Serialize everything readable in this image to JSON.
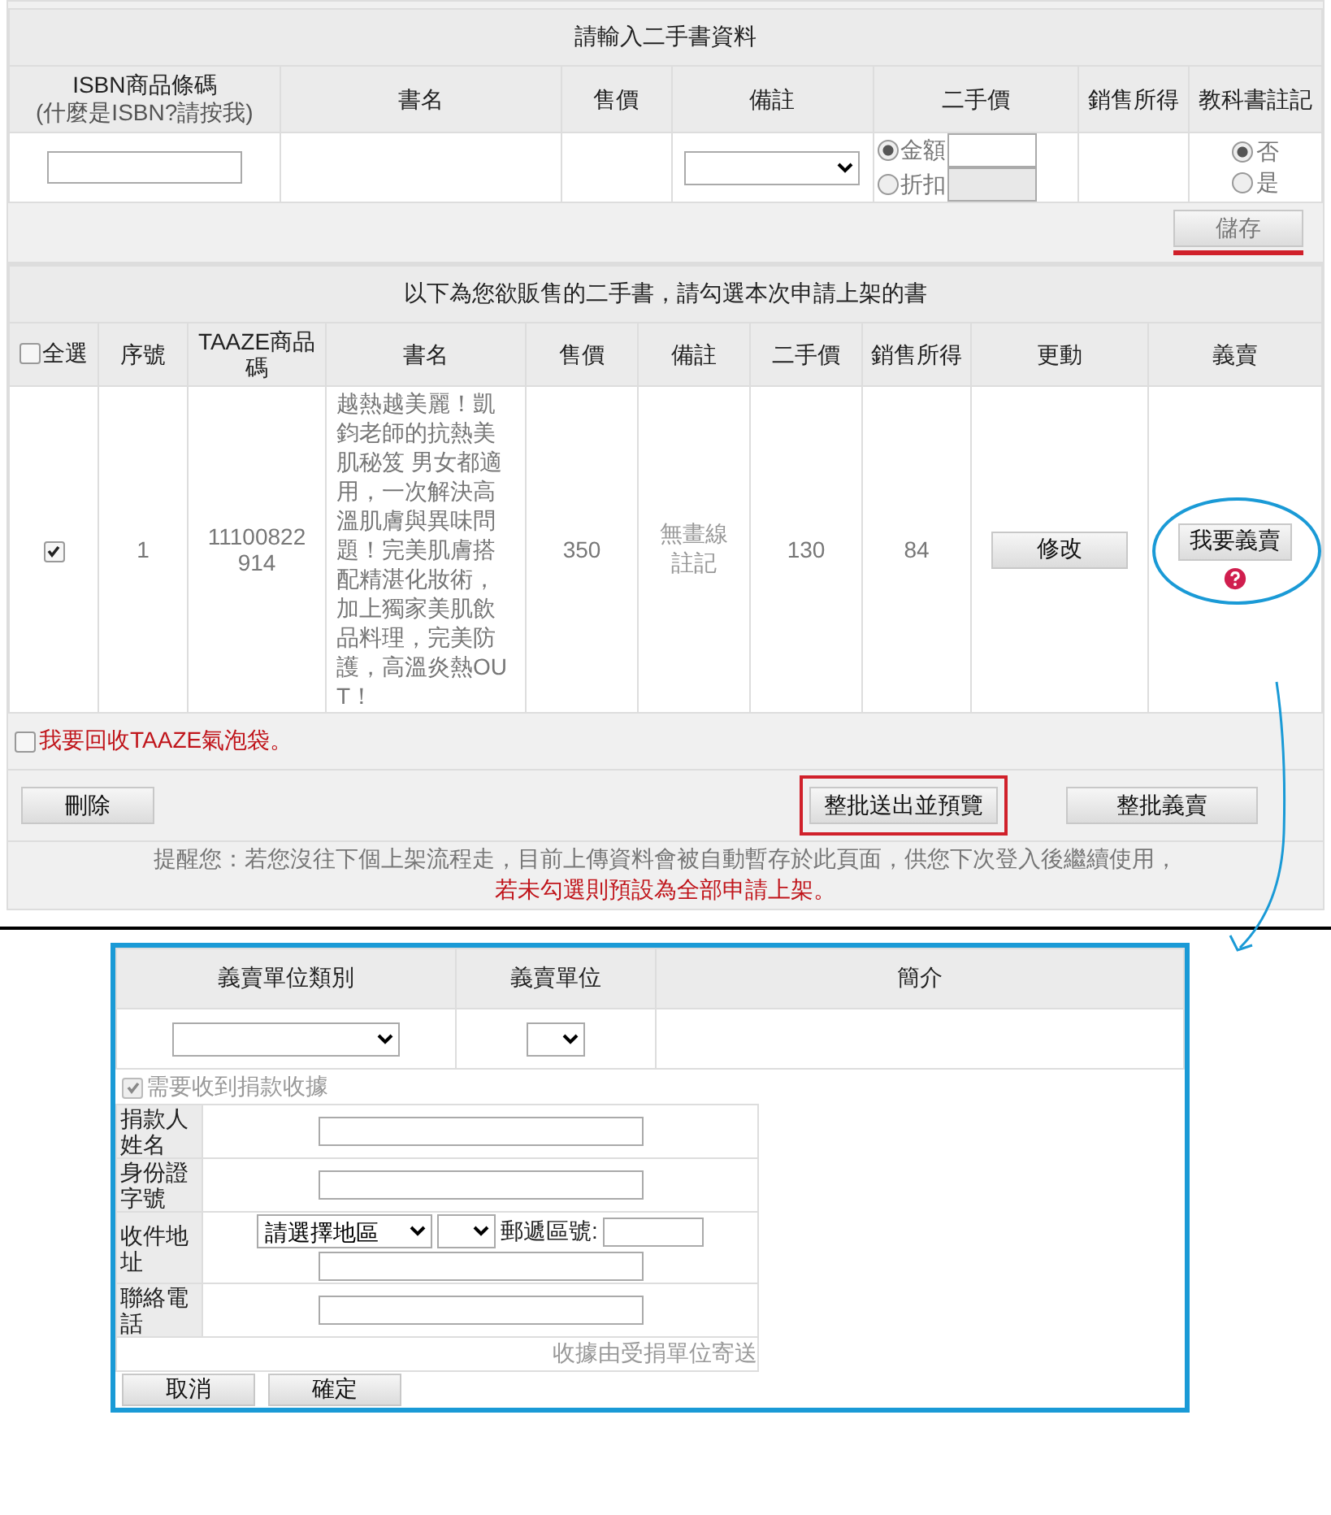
{
  "entry_form": {
    "title": "請輸入二手書資料",
    "columns": [
      {
        "label": "ISBN商品條碼",
        "help_link": "(什麼是ISBN?請按我)"
      },
      {
        "label": "書名"
      },
      {
        "label": "售價"
      },
      {
        "label": "備註"
      },
      {
        "label": "二手價"
      },
      {
        "label": "銷售所得"
      },
      {
        "label": "教科書註記"
      }
    ],
    "price_modes": [
      {
        "label": "金額",
        "selected": true
      },
      {
        "label": "折扣",
        "selected": false
      }
    ],
    "textbook_options": [
      {
        "label": "否",
        "selected": true
      },
      {
        "label": "是",
        "selected": false
      }
    ],
    "save_button": "儲存"
  },
  "listing": {
    "title": "以下為您欲販售的二手書，請勾選本次申請上架的書",
    "select_all": {
      "label": "全選",
      "checked": false
    },
    "columns": [
      "序號",
      "TAAZE商品碼",
      "書名",
      "售價",
      "備註",
      "二手價",
      "銷售所得",
      "更動",
      "義賣"
    ],
    "rows": [
      {
        "checked": true,
        "number": "1",
        "code": "11100822914",
        "title": "越熱越美麗！凱鈞老師的抗熱美肌秘笈 男女都適用，一次解決高溫肌膚與異味問題！完美肌膚搭配精湛化妝術，加上獨家美肌飲品料理，完美防護，高溫炎熱OUT！",
        "price": "350",
        "note": "無畫線註記",
        "used_price": "130",
        "earnings": "84",
        "edit_button": "修改",
        "charity_button": "我要義賣"
      }
    ],
    "bubble_bag": {
      "label": "我要回收TAAZE氣泡袋。",
      "checked": false
    },
    "delete_button": "刪除",
    "preview_button": "整批送出並預覽",
    "batch_charity_button": "整批義賣",
    "reminder": "提醒您：若您沒往下個上架流程走，目前上傳資料會被自動暫存於此頁面，供您下次登入後繼續使用，",
    "warning": "若未勾選則預設為全部申請上架。"
  },
  "charity_form": {
    "columns": [
      "義賣單位類別",
      "義賣單位",
      "簡介"
    ],
    "receipt": {
      "label": "需要收到捐款收據",
      "checked": true,
      "disabled": true
    },
    "fields": [
      {
        "kind": "text",
        "label": "捐款人姓名"
      },
      {
        "kind": "text",
        "label": "身份證字號"
      },
      {
        "kind": "address",
        "label": "收件地址",
        "region": "請選擇地區",
        "postal_label": "郵遞區號:"
      },
      {
        "kind": "text",
        "label": "聯絡電話"
      }
    ],
    "note": "收據由受捐單位寄送",
    "buttons": [
      "取消",
      "確定"
    ]
  }
}
